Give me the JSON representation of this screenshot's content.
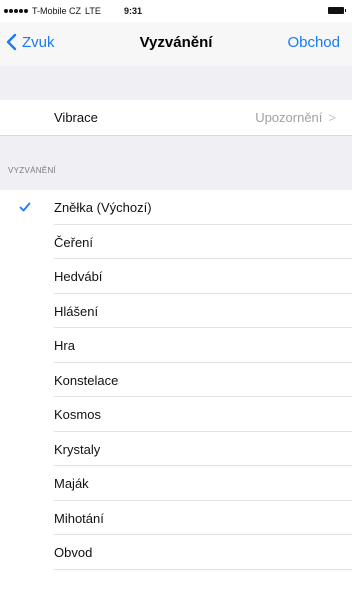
{
  "status_bar": {
    "carrier": "T-Mobile CZ",
    "network": "LTE",
    "time": "9:31"
  },
  "nav": {
    "back_label": "Zvuk",
    "title": "Vyzvánění",
    "action_label": "Obchod"
  },
  "vibration": {
    "label": "Vibrace",
    "value": "Upozornění"
  },
  "ringtones": {
    "header": "VYZVÁNĚNÍ",
    "items": [
      {
        "label": "Zněłka (Výchozí)",
        "selected": true
      },
      {
        "label": "Čeření",
        "selected": false
      },
      {
        "label": "Hedvábí",
        "selected": false
      },
      {
        "label": "Hlášení",
        "selected": false
      },
      {
        "label": "Hra",
        "selected": false
      },
      {
        "label": "Konstelace",
        "selected": false
      },
      {
        "label": "Kosmos",
        "selected": false
      },
      {
        "label": "Krystaly",
        "selected": false
      },
      {
        "label": "Maják",
        "selected": false
      },
      {
        "label": "Mihotání",
        "selected": false
      },
      {
        "label": "Obvod",
        "selected": false
      }
    ]
  },
  "colors": {
    "accent": "#1a7bf2",
    "group_background": "#efeff4",
    "secondary_text": "#a0a0a6"
  }
}
